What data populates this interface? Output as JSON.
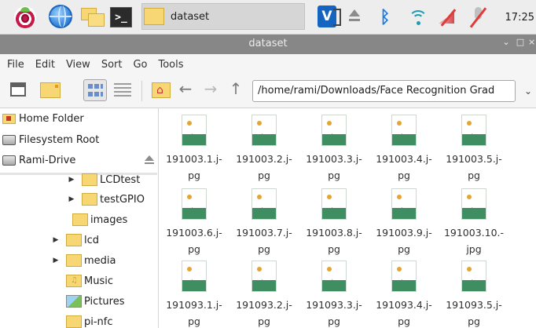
{
  "taskbar": {
    "window_button_label": "dataset",
    "terminal_glyph": ">_",
    "vnc_glyph": "V",
    "bluetooth_glyph": "ᛒ",
    "clock": "17:25"
  },
  "window": {
    "title": "dataset",
    "minimize_glyph": "⌄",
    "maximize_glyph": "□",
    "close_glyph": "×"
  },
  "menu": [
    "File",
    "Edit",
    "View",
    "Sort",
    "Go",
    "Tools"
  ],
  "toolbar": {
    "back_glyph": "←",
    "forward_glyph": "→",
    "up_glyph": "↑",
    "location": "/home/rami/Downloads/Face Recognition Grad",
    "dropdown_glyph": "⌄"
  },
  "sidepane": {
    "places": [
      {
        "label": "Home Folder"
      },
      {
        "label": "Filesystem Root"
      },
      {
        "label": "Rami-Drive"
      }
    ],
    "tree": [
      {
        "label": "LCDtest",
        "arrow": "▶"
      },
      {
        "label": "testGPIO",
        "arrow": "▶"
      },
      {
        "label": "images",
        "arrow": ""
      },
      {
        "label": "lcd",
        "arrow": "▶"
      },
      {
        "label": "media",
        "arrow": "▶"
      },
      {
        "label": "Music",
        "arrow": ""
      },
      {
        "label": "Pictures",
        "arrow": ""
      },
      {
        "label": "pi-nfc",
        "arrow": ""
      }
    ]
  },
  "files": [
    {
      "line1": "191003.1.j-",
      "line2": "pg"
    },
    {
      "line1": "191003.2.j-",
      "line2": "pg"
    },
    {
      "line1": "191003.3.j-",
      "line2": "pg"
    },
    {
      "line1": "191003.4.j-",
      "line2": "pg"
    },
    {
      "line1": "191003.5.j-",
      "line2": "pg"
    },
    {
      "line1": "191003.6.j-",
      "line2": "pg"
    },
    {
      "line1": "191003.7.j-",
      "line2": "pg"
    },
    {
      "line1": "191003.8.j-",
      "line2": "pg"
    },
    {
      "line1": "191003.9.j-",
      "line2": "pg"
    },
    {
      "line1": "191003.10.-",
      "line2": "jpg"
    },
    {
      "line1": "191093.1.j-",
      "line2": "pg"
    },
    {
      "line1": "191093.2.j-",
      "line2": "pg"
    },
    {
      "line1": "191093.3.j-",
      "line2": "pg"
    },
    {
      "line1": "191093.4.j-",
      "line2": "pg"
    },
    {
      "line1": "191093.5.j-",
      "line2": "pg"
    }
  ]
}
